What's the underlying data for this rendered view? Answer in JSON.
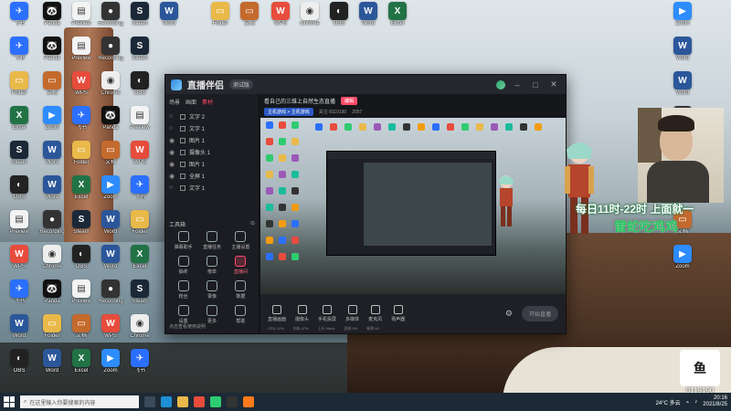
{
  "desktop": {
    "icons": [
      {
        "label": "飞书",
        "color": "#2b6fff",
        "glyph": "✈"
      },
      {
        "label": "Panda",
        "color": "#111111",
        "glyph": "🐼"
      },
      {
        "label": "Preview",
        "color": "#f3f3f3",
        "glyph": "▤"
      },
      {
        "label": "Recording",
        "color": "#333333",
        "glyph": "●"
      },
      {
        "label": "Steam",
        "color": "#1b2838",
        "glyph": "S"
      },
      {
        "label": "Word",
        "color": "#2b579a",
        "glyph": "W"
      },
      {
        "label": "Folder",
        "color": "#e9b949",
        "glyph": "▭"
      },
      {
        "label": "文档",
        "color": "#c46a2d",
        "glyph": "▭"
      },
      {
        "label": "WPS",
        "color": "#e74c3c",
        "glyph": "W"
      },
      {
        "label": "Chrome",
        "color": "#eeeeee",
        "glyph": "◉"
      },
      {
        "label": "OBS",
        "color": "#222222",
        "glyph": "◐"
      },
      {
        "label": "Word",
        "color": "#2b579a",
        "glyph": "W"
      },
      {
        "label": "Excel",
        "color": "#217346",
        "glyph": "X"
      },
      {
        "label": "Zoom",
        "color": "#2d8cff",
        "glyph": "▶"
      }
    ],
    "taskbar": {
      "search_placeholder": "在这里输入你要搜索的内容",
      "weather": "24°C 多云",
      "time": "20:16",
      "date": "2021/8/25"
    }
  },
  "app": {
    "title": "直播伴侣",
    "version": "测试版",
    "left_tabs": [
      "场景",
      "画面",
      "素材"
    ],
    "scenes": [
      {
        "name": "文字 2"
      },
      {
        "name": "文字 1"
      },
      {
        "name": "图片 1"
      },
      {
        "name": "摄像头 1"
      },
      {
        "name": "图片 1"
      },
      {
        "name": "全屏 1"
      },
      {
        "name": "文字 1"
      }
    ],
    "tools_header": "工具箱",
    "tools": [
      {
        "label": "弹幕助手"
      },
      {
        "label": "直播任务"
      },
      {
        "label": "主播设置"
      },
      {
        "label": "抽奖"
      },
      {
        "label": "榜单"
      },
      {
        "label": "直播间"
      },
      {
        "label": "粉丝"
      },
      {
        "label": "录像"
      },
      {
        "label": "数据"
      },
      {
        "label": "设置"
      },
      {
        "label": "更多"
      },
      {
        "label": "帮助"
      }
    ],
    "footer": "点击查看使用说明",
    "room": {
      "title": "看自己的三维上自然生态直播",
      "edit": "编辑",
      "category": "主机游戏 > 主机游戏",
      "fans": "关注 8119190",
      "hot": "2057"
    },
    "bottom_bar": {
      "items": [
        "直播画面",
        "摄像头",
        "手机投屏",
        "多媒体",
        "麦克风",
        "扬声器"
      ],
      "start_button": "开始直播",
      "stats": [
        "CPU 12%",
        "内存 47%",
        "上行 0kb/s",
        "丢帧 0%",
        "帧率 60"
      ]
    }
  },
  "overlay": {
    "schedule": "每日11时-22时 上面就一",
    "slogan": "雷蛇吃鸡鸡",
    "room_number": "8119190"
  }
}
